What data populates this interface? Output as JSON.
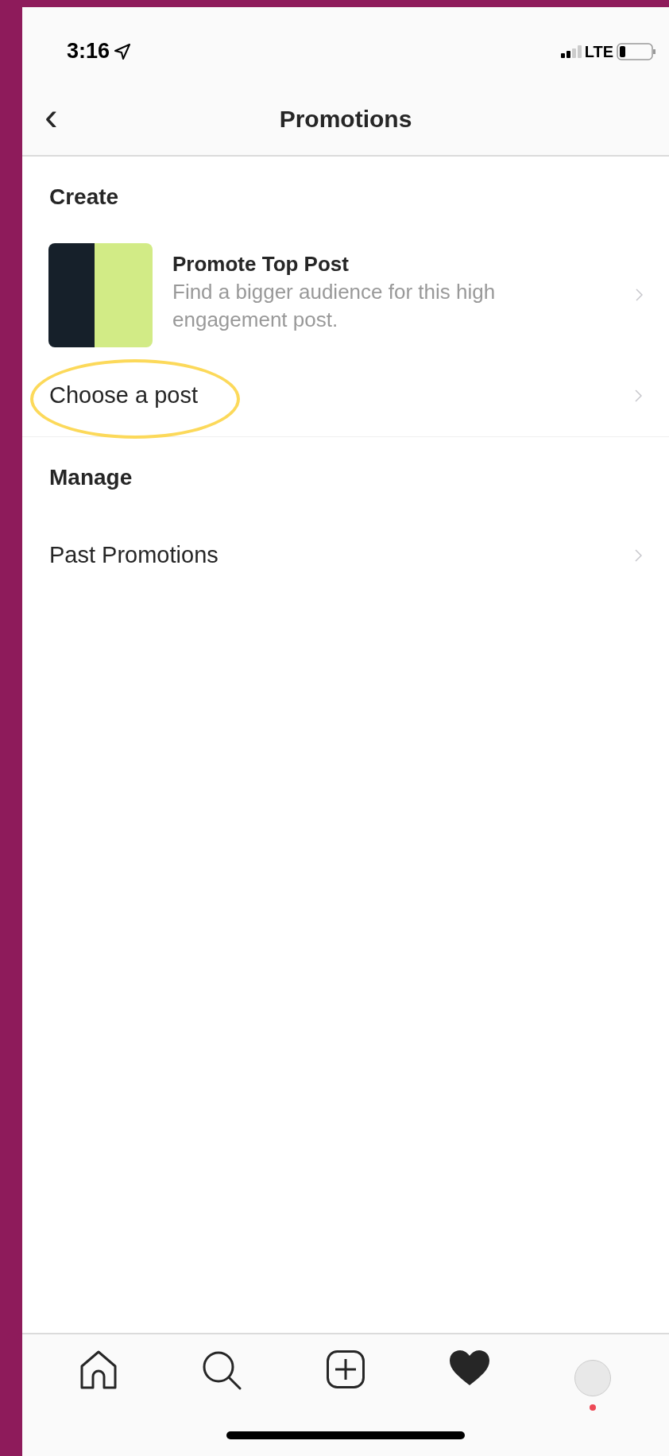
{
  "status_bar": {
    "time": "3:16",
    "network": "LTE"
  },
  "nav_bar": {
    "back": "‹",
    "title": "Promotions"
  },
  "sections": [
    {
      "heading": "Create",
      "rows": [
        {
          "kind": "post",
          "title": "Promote Top Post",
          "subtitle": "Find a bigger audience for this high engagement post.",
          "highlighted": false
        },
        {
          "kind": "link",
          "title": "Choose a post",
          "highlighted": true
        }
      ]
    },
    {
      "heading": "Manage",
      "rows": [
        {
          "kind": "link",
          "title": "Past Promotions",
          "highlighted": false
        }
      ]
    }
  ],
  "tab_bar": [
    {
      "kind": "home"
    },
    {
      "kind": "search"
    },
    {
      "kind": "add"
    },
    {
      "kind": "heart"
    },
    {
      "kind": "profile",
      "badge": true
    }
  ]
}
